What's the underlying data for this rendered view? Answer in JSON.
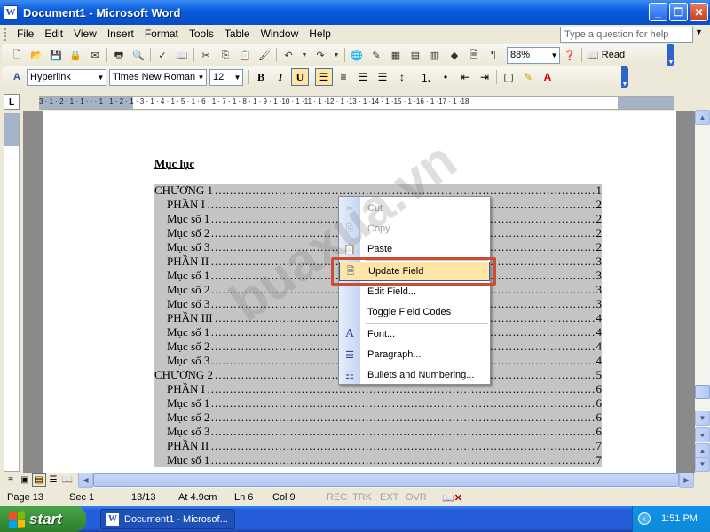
{
  "window": {
    "title": "Document1 - Microsoft Word",
    "app_icon_letter": "W"
  },
  "menubar": {
    "items": [
      "File",
      "Edit",
      "View",
      "Insert",
      "Format",
      "Tools",
      "Table",
      "Window",
      "Help"
    ],
    "ask_placeholder": "Type a question for help"
  },
  "standard_toolbar": {
    "zoom": "88%",
    "read_label": "Read"
  },
  "formatting_toolbar": {
    "style": "Hyperlink",
    "font": "Times New Roman",
    "size": "12"
  },
  "ruler": {
    "marks": "3 · 1 · 2 · 1 · 1 ·  ·  · 1 · 1 · 2 · 1 · 3 · 1 · 4 · 1 · 5 · 1 · 6 · 1 · 7 · 1 · 8 · 1 · 9 · 1 ·10 · 1 ·11 · 1 ·12 · 1 ·13 · 1 ·14 · 1 ·15 · 1 ·16 · 1 ·17 · 1 ·18"
  },
  "document": {
    "heading": "Mục lục",
    "toc": [
      {
        "text": "CHƯƠNG 1",
        "page": "1",
        "indent": false
      },
      {
        "text": "PHẦN I",
        "page": "2",
        "indent": true
      },
      {
        "text": "Mục số 1",
        "page": "2",
        "indent": true
      },
      {
        "text": "Mục số 2",
        "page": "2",
        "indent": true
      },
      {
        "text": "Mục số 3",
        "page": "2",
        "indent": true
      },
      {
        "text": "PHẦN II",
        "page": "3",
        "indent": true
      },
      {
        "text": "Mục số 1",
        "page": "3",
        "indent": true
      },
      {
        "text": "Mục số 2",
        "page": "3",
        "indent": true
      },
      {
        "text": "Mục số 3",
        "page": "3",
        "indent": true
      },
      {
        "text": "PHẦN III",
        "page": "4",
        "indent": true
      },
      {
        "text": "Mục số 1",
        "page": "4",
        "indent": true
      },
      {
        "text": "Mục số 2",
        "page": "4",
        "indent": true
      },
      {
        "text": "Mục số 3",
        "page": "4",
        "indent": true
      },
      {
        "text": "CHƯƠNG 2",
        "page": "5",
        "indent": false
      },
      {
        "text": "PHẦN I",
        "page": "6",
        "indent": true
      },
      {
        "text": "Mục số 1",
        "page": "6",
        "indent": true
      },
      {
        "text": "Mục số 2",
        "page": "6",
        "indent": true
      },
      {
        "text": "Mục số 3",
        "page": "6",
        "indent": true
      },
      {
        "text": "PHẦN II",
        "page": "7",
        "indent": true
      },
      {
        "text": "Mục số 1",
        "page": "7",
        "indent": true
      }
    ]
  },
  "context_menu": {
    "items": [
      {
        "label": "Cut",
        "icon": "scissors-icon",
        "disabled": true
      },
      {
        "label": "Copy",
        "icon": "copy-icon",
        "disabled": true
      },
      {
        "label": "Paste",
        "icon": "paste-icon",
        "disabled": false
      },
      {
        "label": "Update Field",
        "icon": "update-field-icon",
        "disabled": false,
        "highlighted": true
      },
      {
        "label": "Edit Field...",
        "icon": "",
        "disabled": false
      },
      {
        "label": "Toggle Field Codes",
        "icon": "",
        "disabled": false
      },
      {
        "label": "Font...",
        "icon": "font-icon",
        "disabled": false
      },
      {
        "label": "Paragraph...",
        "icon": "paragraph-icon",
        "disabled": false
      },
      {
        "label": "Bullets and Numbering...",
        "icon": "bullets-icon",
        "disabled": false
      }
    ]
  },
  "statusbar": {
    "page": "Page 13",
    "sec": "Sec 1",
    "pages": "13/13",
    "at": "At 4.9cm",
    "ln": "Ln 6",
    "col": "Col 9",
    "rec": "REC",
    "trk": "TRK",
    "ext": "EXT",
    "ovr": "OVR"
  },
  "taskbar": {
    "start_label": "start",
    "task_label": "Document1 - Microsof...",
    "clock": "1:51 PM"
  },
  "watermark": "buaxua.vn",
  "colors": {
    "title_bar": "#0A5FE0",
    "highlight_outline": "#cb4d34",
    "field_shading": "#c4c4c4",
    "taskbar": "#245EDB",
    "start_button": "#3a913a"
  }
}
